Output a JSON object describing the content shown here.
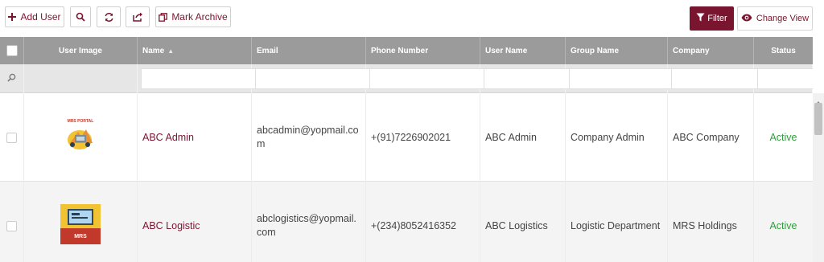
{
  "toolbar": {
    "add_user_label": "Add User",
    "mark_archive_label": "Mark Archive",
    "filter_label": "Filter",
    "change_view_label": "Change View"
  },
  "colors": {
    "accent": "#7a1530",
    "header_bg": "#9b9b9b",
    "status_active": "#2e9e3a"
  },
  "table": {
    "columns": [
      "User Image",
      "Name",
      "Email",
      "Phone Number",
      "User Name",
      "Group Name",
      "Company",
      "Status"
    ],
    "clear_glyph": "x",
    "rows": [
      {
        "image_title": "MRS PORTAL",
        "name": "ABC Admin",
        "email": "abcadmin@yopmail.com",
        "phone": "+(91)7226902021",
        "username": "ABC Admin",
        "group": "Company Admin",
        "company": "ABC Company",
        "status": "Active"
      },
      {
        "image_title": "MRS",
        "name": "ABC Logistic",
        "email": "abclogistics@yopmail.com",
        "phone": "+(234)8052416352",
        "username": "ABC Logistics",
        "group": "Logistic Department",
        "company": "MRS Holdings",
        "status": "Active"
      }
    ]
  }
}
